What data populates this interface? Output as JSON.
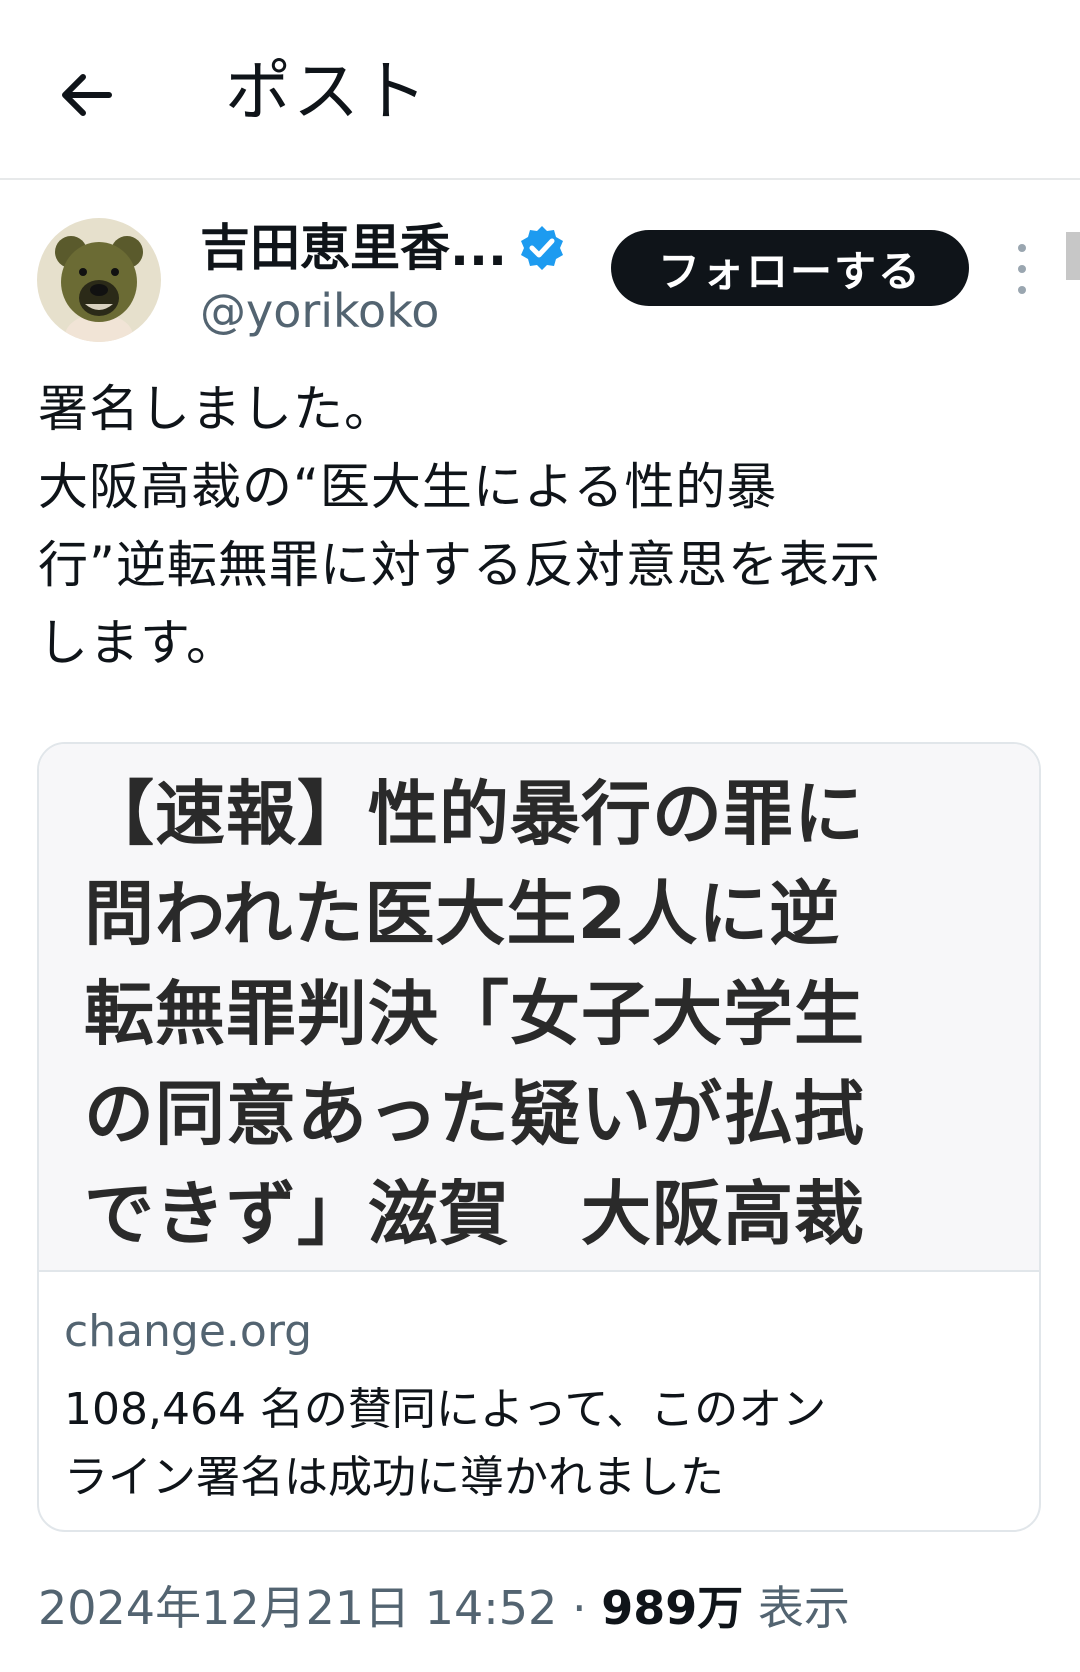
{
  "header": {
    "title": "ポスト"
  },
  "author": {
    "display_name": "吉田恵里香...",
    "handle": "@yorikoko"
  },
  "follow_button": {
    "label": "フォローする"
  },
  "tweet": {
    "lines": [
      "署名しました。",
      "大阪高裁の“医大生による性的暴",
      "行”逆転無罪に対する反対意思を表示",
      "します。"
    ]
  },
  "card": {
    "headline_lines": [
      "【速報】性的暴行の罪に",
      "問われた医大生2人に逆",
      "転無罪判決「女子大学生",
      "の同意あった疑いが払拭",
      "できず」滋賀　大阪高裁"
    ],
    "domain": "change.org",
    "description_lines": [
      "108,464 名の賛同によって、このオン",
      "ライン署名は成功に導かれました"
    ]
  },
  "meta": {
    "timestamp": "2024年12月21日 14:52",
    "separator": "·",
    "views_count": "989万",
    "views_label": "表示"
  },
  "colors": {
    "text_primary": "#0f1419",
    "text_secondary": "#536471",
    "verified_blue": "#1d9bf0",
    "follow_bg": "#0f1419",
    "border": "#e7e9ea"
  },
  "icons": {
    "back": "arrow-left-icon",
    "verified": "verified-badge-icon",
    "more": "more-vertical-icon"
  }
}
